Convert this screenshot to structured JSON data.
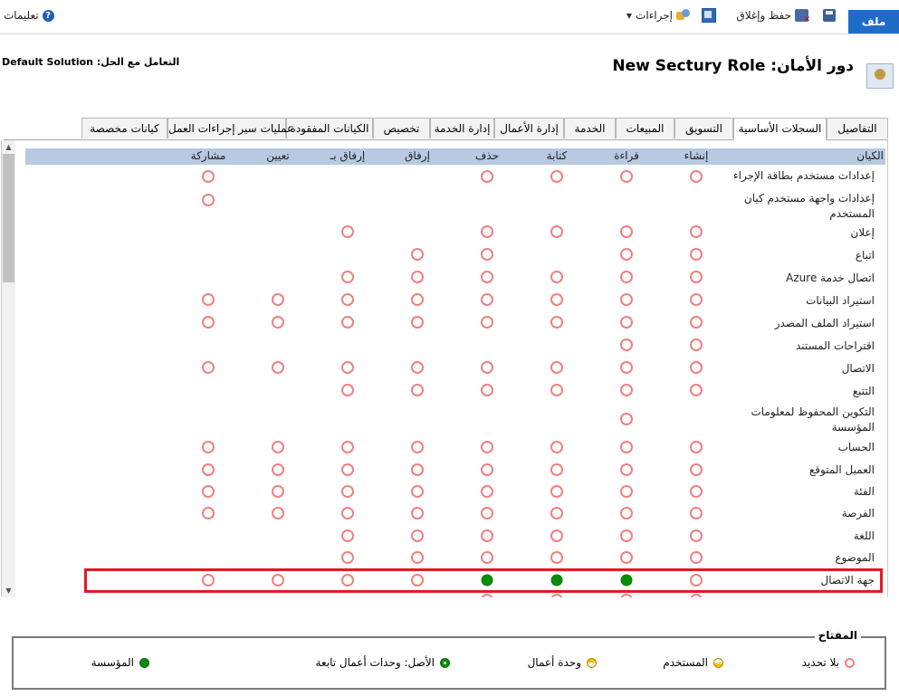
{
  "toolbar": {
    "file_label": "ملف",
    "save_close_label": "حفظ وإغلاق",
    "actions_label": "إجراءات",
    "help_label": "تعليمات"
  },
  "header": {
    "role_title": "دور الأمان: New Sectury Role",
    "solution_label": "التعامل مع الحل: Default Solution"
  },
  "tabs": [
    {
      "label": "التفاصيل",
      "active": false
    },
    {
      "label": "السجلات الأساسية",
      "active": true
    },
    {
      "label": "التسويق",
      "active": false
    },
    {
      "label": "المبيعات",
      "active": false
    },
    {
      "label": "الخدمة",
      "active": false
    },
    {
      "label": "إدارة الأعمال",
      "active": false
    },
    {
      "label": "إدارة الخدمة",
      "active": false
    },
    {
      "label": "تخصيص",
      "active": false
    },
    {
      "label": "الكيانات المفقودة",
      "active": false
    },
    {
      "label": "عمليات سير إجراءات العمل",
      "active": false
    },
    {
      "label": "كيانات مخصصة",
      "active": false
    }
  ],
  "grid": {
    "entity_header": "الكيان",
    "columns": [
      "إنشاء",
      "قراءة",
      "كتابة",
      "حذف",
      "إرفاق",
      "إرفاق بـ",
      "تعيين",
      "مشاركة"
    ],
    "rows": [
      {
        "entity": "إعدادات مستخدم بطاقة الإجراء",
        "levels": [
          "none",
          "none",
          "none",
          "none",
          "",
          "",
          "",
          "none"
        ]
      },
      {
        "entity": "إعدادات واجهة مستخدم كيان المستخدم",
        "levels": [
          "",
          "",
          "",
          "",
          "",
          "",
          "",
          "none"
        ]
      },
      {
        "entity": "إعلان",
        "levels": [
          "none",
          "none",
          "none",
          "none",
          "",
          "none",
          "",
          ""
        ]
      },
      {
        "entity": "اتباع",
        "levels": [
          "none",
          "none",
          "",
          "none",
          "none",
          "",
          "",
          ""
        ]
      },
      {
        "entity": "اتصال خدمة Azure",
        "levels": [
          "none",
          "none",
          "none",
          "none",
          "none",
          "none",
          "",
          ""
        ]
      },
      {
        "entity": "استيراد البيانات",
        "levels": [
          "none",
          "none",
          "none",
          "none",
          "none",
          "none",
          "none",
          "none"
        ]
      },
      {
        "entity": "استيراد الملف المصدر",
        "levels": [
          "none",
          "none",
          "none",
          "none",
          "none",
          "none",
          "none",
          "none"
        ]
      },
      {
        "entity": "اقتراحات المستند",
        "levels": [
          "none",
          "none",
          "",
          "",
          "",
          "",
          "",
          ""
        ]
      },
      {
        "entity": "الاتصال",
        "levels": [
          "none",
          "none",
          "none",
          "none",
          "none",
          "none",
          "none",
          "none"
        ]
      },
      {
        "entity": "التتبع",
        "levels": [
          "none",
          "none",
          "none",
          "none",
          "none",
          "none",
          "",
          ""
        ]
      },
      {
        "entity": "التكوين المحفوظ لمعلومات المؤسسة",
        "levels": [
          "",
          "none",
          "",
          "",
          "",
          "",
          "",
          ""
        ]
      },
      {
        "entity": "الحساب",
        "levels": [
          "none",
          "none",
          "none",
          "none",
          "none",
          "none",
          "none",
          "none"
        ]
      },
      {
        "entity": "العميل المتوقع",
        "levels": [
          "none",
          "none",
          "none",
          "none",
          "none",
          "none",
          "none",
          "none"
        ]
      },
      {
        "entity": "الفئة",
        "levels": [
          "none",
          "none",
          "none",
          "none",
          "none",
          "none",
          "none",
          "none"
        ]
      },
      {
        "entity": "الفرصة",
        "levels": [
          "none",
          "none",
          "none",
          "none",
          "none",
          "none",
          "none",
          "none"
        ]
      },
      {
        "entity": "اللغة",
        "levels": [
          "none",
          "none",
          "none",
          "none",
          "none",
          "none",
          "",
          ""
        ]
      },
      {
        "entity": "الموضوع",
        "levels": [
          "none",
          "none",
          "none",
          "none",
          "none",
          "none",
          "",
          ""
        ]
      },
      {
        "entity": "جهة الاتصال",
        "levels": [
          "none",
          "org",
          "org",
          "org",
          "none",
          "none",
          "none",
          "none"
        ],
        "highlighted": true
      },
      {
        "entity": "",
        "levels": [
          "none",
          "none",
          "none",
          "none",
          "",
          "",
          "",
          ""
        ]
      }
    ]
  },
  "legend": {
    "title": "المفتاح",
    "items": [
      {
        "label": "بلا تحديد",
        "icon": "none-level-icon"
      },
      {
        "label": "المستخدم",
        "icon": "user-level-icon"
      },
      {
        "label": "وحدة أعمال",
        "icon": "business-unit-level-icon"
      },
      {
        "label": "الأصل: وحدات أعمال تابعة",
        "icon": "parent-child-level-icon"
      },
      {
        "label": "المؤسسة",
        "icon": "organization-level-icon"
      }
    ]
  },
  "colors": {
    "none": "#f08080",
    "organization": "#0a8d0a",
    "highlight_border": "#e01b22",
    "header_row": "#b8c9e1",
    "file_button": "#1f6cc7"
  }
}
